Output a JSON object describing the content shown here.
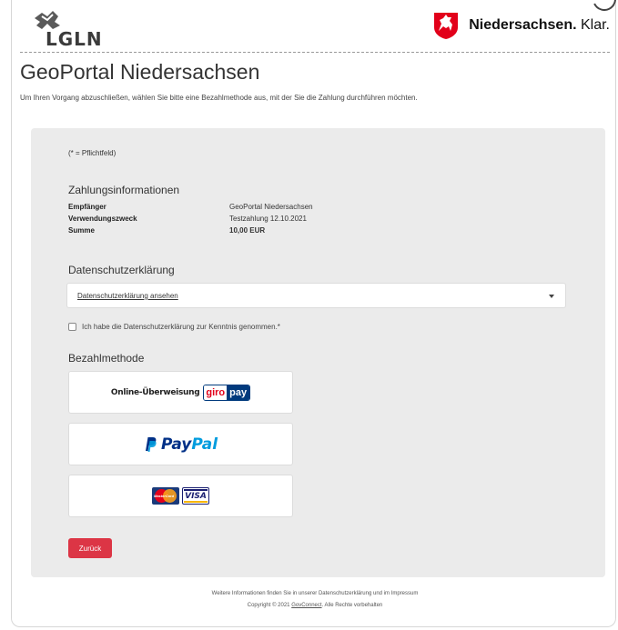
{
  "header": {
    "left_logo_text": "LGLN",
    "right_logo_brand": "Niedersachsen.",
    "right_logo_tagline": "Klar."
  },
  "page": {
    "title": "GeoPortal Niedersachsen",
    "intro": "Um Ihren Vorgang abzuschließen, wählen Sie bitte eine Bezahlmethode aus, mit der Sie die Zahlung durchführen möchten."
  },
  "form": {
    "required_note": "(* = Pflichtfeld)",
    "payment_info_title": "Zahlungsinformationen",
    "payment_info": [
      {
        "label": "Empfänger",
        "value": "GeoPortal Niedersachsen",
        "bold": false
      },
      {
        "label": "Verwendungszweck",
        "value": "Testzahlung 12.10.2021",
        "bold": false
      },
      {
        "label": "Summe",
        "value": "10,00 EUR",
        "bold": true
      }
    ],
    "privacy_title": "Datenschutzerklärung",
    "privacy_select_value": "Datenschutzerklärung ansehen",
    "privacy_checkbox_label": "Ich habe die Datenschutzerklärung zur Kenntnis genommen.*",
    "privacy_checkbox_checked": false,
    "payment_method_title": "Bezahlmethode",
    "payment_methods": {
      "giropay_text": "Online-Überweisung",
      "giropay_logo_part1": "giro",
      "giropay_logo_part2": "pay",
      "paypal_part1": "Pay",
      "paypal_part2": "Pal",
      "mastercard_label": "MasterCard",
      "visa_label": "VISA"
    },
    "back_button": "Zurück"
  },
  "footer": {
    "line1": "Weitere Informationen finden Sie in unserer Datenschutzerklärung und im Impressum",
    "line2_prefix": "Copyright © 2021",
    "line2_link": "GovConnect",
    "line2_suffix": ". Alle Rechte vorbehalten"
  },
  "colors": {
    "panel_bg": "#ebebeb",
    "back_button_bg": "#dc3545",
    "giropay_blue": "#003a7d",
    "giropay_red": "#e2001a",
    "paypal_dark": "#003087",
    "paypal_light": "#009cde"
  }
}
